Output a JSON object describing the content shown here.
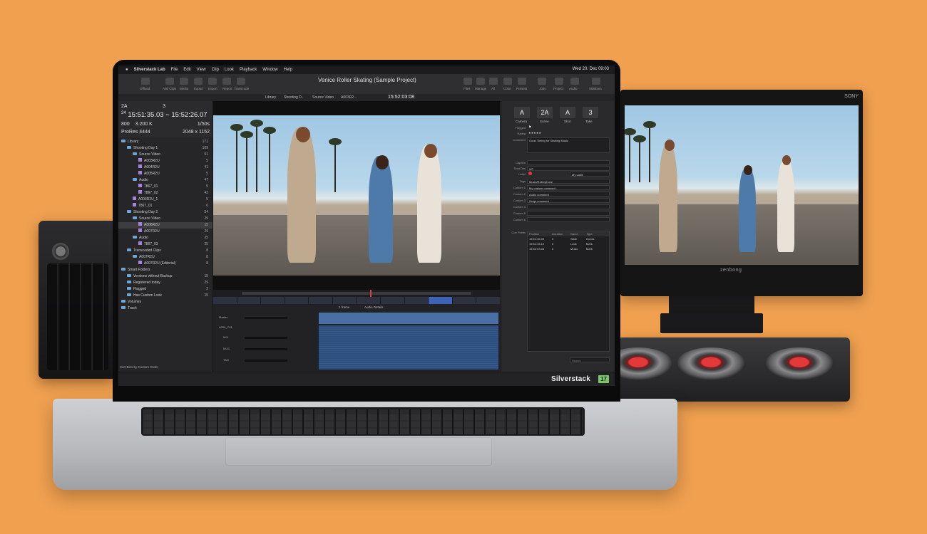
{
  "menubar": {
    "app": "Silverstack Lab",
    "items": [
      "File",
      "Edit",
      "View",
      "Clip",
      "Look",
      "Playback",
      "Window",
      "Help"
    ],
    "clock": "Wed 20. Dec 09:03"
  },
  "toolbar": {
    "title": "Venice Roller Skating (Sample Project)",
    "left_labels": [
      "Offload",
      "Add Clips",
      "Media",
      "Export",
      "Import",
      "Report",
      "Transcode"
    ],
    "right_labels": [
      "Files",
      "Manage",
      "All",
      "Color",
      "Presets",
      "Jobs",
      "Project",
      "Audio",
      "Sidebars"
    ]
  },
  "subbar": {
    "breadcrumb": [
      "Library",
      "Shooting D..",
      "Source Video",
      "A003R2..."
    ],
    "timecode": "15:52:03:08"
  },
  "sidebar": {
    "top": {
      "cam": "2A",
      "shot": "3",
      "tc_in": "15:51:35.03",
      "tc_sep": "~",
      "tc_out": "15:52:26.07",
      "fps": "24",
      "iso": "800",
      "kelvin": "3.200 K",
      "shutter": "1/50s",
      "codec": "ProRes 4444",
      "resolution": "2048 x 1152"
    },
    "tree": [
      {
        "label": "Library",
        "count": "171",
        "indent": 0,
        "type": "folder"
      },
      {
        "label": "Shooting Day 1",
        "count": "109",
        "indent": 1,
        "type": "folder"
      },
      {
        "label": "Source Video",
        "count": "51",
        "indent": 2,
        "type": "folder"
      },
      {
        "label": "A003R2U",
        "count": "5",
        "indent": 3,
        "type": "clip"
      },
      {
        "label": "A004R2U",
        "count": "41",
        "indent": 3,
        "type": "clip"
      },
      {
        "label": "A005R2U",
        "count": "5",
        "indent": 3,
        "type": "clip"
      },
      {
        "label": "Audio",
        "count": "47",
        "indent": 2,
        "type": "folder"
      },
      {
        "label": "7867_01",
        "count": "5",
        "indent": 3,
        "type": "clip"
      },
      {
        "label": "7867_02",
        "count": "42",
        "indent": 3,
        "type": "clip"
      },
      {
        "label": "A003R2U_1",
        "count": "5",
        "indent": 2,
        "type": "clip"
      },
      {
        "label": "7867_01",
        "count": "6",
        "indent": 2,
        "type": "clip"
      },
      {
        "label": "Shooting Day 2",
        "count": "54",
        "indent": 1,
        "type": "folder"
      },
      {
        "label": "Source Video",
        "count": "29",
        "indent": 2,
        "type": "folder"
      },
      {
        "label": "A006R2U",
        "count": "15",
        "indent": 3,
        "type": "clip",
        "selected": true
      },
      {
        "label": "A007R2U",
        "count": "29",
        "indent": 3,
        "type": "clip"
      },
      {
        "label": "Audio",
        "count": "25",
        "indent": 2,
        "type": "folder"
      },
      {
        "label": "7867_03",
        "count": "25",
        "indent": 3,
        "type": "clip"
      },
      {
        "label": "Transcoded Clips",
        "count": "8",
        "indent": 1,
        "type": "folder"
      },
      {
        "label": "A007R2U",
        "count": "8",
        "indent": 2,
        "type": "folder"
      },
      {
        "label": "A007R2U (Editorial)",
        "count": "8",
        "indent": 3,
        "type": "clip"
      },
      {
        "label": "Smart Folders",
        "count": "",
        "indent": 0,
        "type": "folder"
      },
      {
        "label": "Versions without Backup",
        "count": "15",
        "indent": 1,
        "type": "smart"
      },
      {
        "label": "Registered today",
        "count": "29",
        "indent": 1,
        "type": "smart"
      },
      {
        "label": "Flagged",
        "count": "2",
        "indent": 1,
        "type": "smart"
      },
      {
        "label": "Has Custom Look",
        "count": "15",
        "indent": 1,
        "type": "smart"
      },
      {
        "label": "Volumes",
        "count": "",
        "indent": 0,
        "type": "folder"
      },
      {
        "label": "Trash",
        "count": "",
        "indent": 0,
        "type": "folder"
      }
    ],
    "bottom": "Sort Bins by Custom Order"
  },
  "audio": {
    "toolbar": [
      "1 frame",
      "Audio Details"
    ],
    "tracks": [
      "Master",
      "A006_C01",
      "MIX",
      "MUS",
      "TAG"
    ]
  },
  "meta": {
    "header_values": [
      "A",
      "2A",
      "A",
      "3"
    ],
    "header_labels": [
      "Camera",
      "Scene",
      "Shot",
      "Take"
    ],
    "flagged_label": "Flagged",
    "rating_label": "Rating",
    "comment_label": "Comment",
    "comment_value": "Good Timing for Starting Music",
    "caption_label": "Caption",
    "shot_desc_label": "Shot Des",
    "shot_desc_value": "WT",
    "label_label": "Label",
    "label_value": "My Label",
    "tags_label": "Tags",
    "tags_value": "Music/Rollerphone",
    "customs": [
      {
        "label": "Custom 1",
        "value": "My custom comment"
      },
      {
        "label": "Custom 2",
        "value": "Audio comment"
      },
      {
        "label": "Custom 3",
        "value": "Script comment"
      },
      {
        "label": "Custom 4",
        "value": ""
      },
      {
        "label": "Custom 5",
        "value": ""
      },
      {
        "label": "Custom 6",
        "value": ""
      }
    ],
    "cue_label": "Cue Points",
    "cue_headers": [
      "Position",
      "Duration",
      "Name",
      "Type"
    ],
    "cues": [
      [
        "15:51:36.03",
        "0",
        "Slate",
        "Guess"
      ],
      [
        "15:51:46.13",
        "0",
        "Look",
        "Mark"
      ],
      [
        "15:52:03.03",
        "0",
        "Music",
        "Mark"
      ]
    ],
    "search_placeholder": "Search"
  },
  "status": {
    "brand": "Silverstack",
    "version": "17"
  },
  "monitor": {
    "brand": "SONY",
    "logo": "zenbong"
  }
}
